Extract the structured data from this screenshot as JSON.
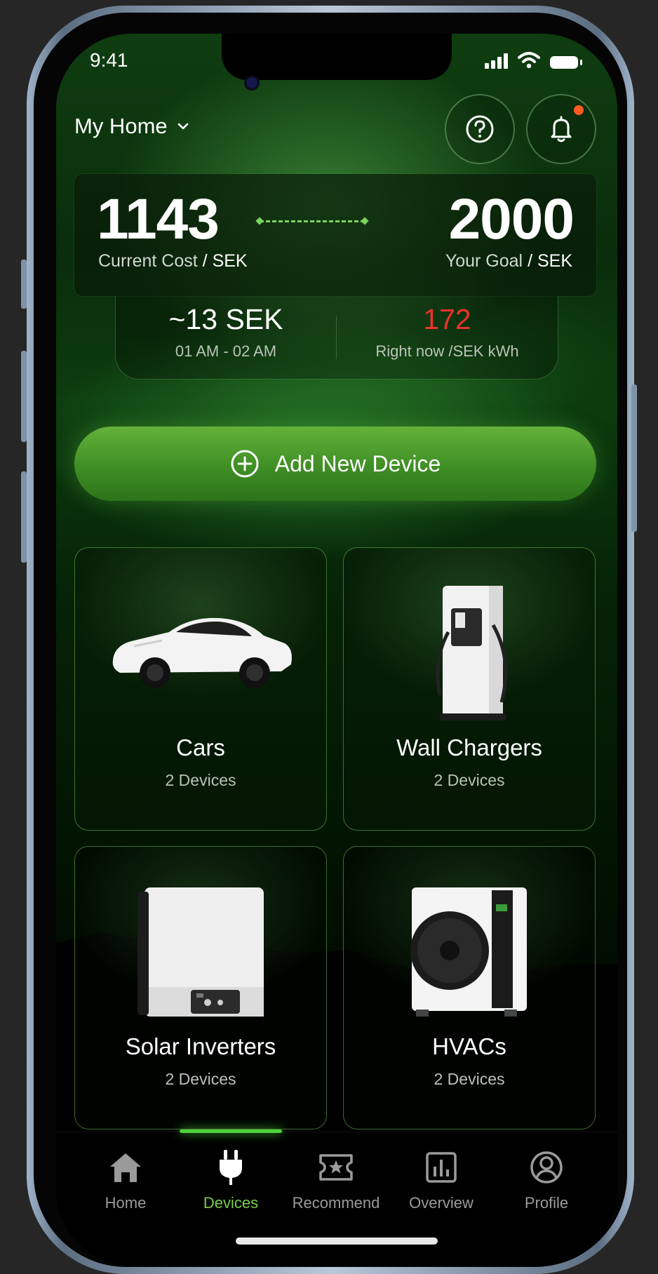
{
  "status_bar": {
    "time": "9:41"
  },
  "header": {
    "home_name": "My Home"
  },
  "cost": {
    "current_value": "1143",
    "current_label": "Current Cost",
    "current_unit": "/ SEK",
    "goal_value": "2000",
    "goal_label": "Your Goal",
    "goal_unit": "/ SEK"
  },
  "rates": {
    "estimate": "~13 SEK",
    "time_window": "01 AM - 02 AM",
    "current_price": "172",
    "current_price_label": "Right now /SEK kWh"
  },
  "add_device_label": "Add New Device",
  "devices": [
    {
      "title": "Cars",
      "count": "2 Devices",
      "icon": "car-image"
    },
    {
      "title": "Wall Chargers",
      "count": "2 Devices",
      "icon": "wall-charger-image"
    },
    {
      "title": "Solar Inverters",
      "count": "2 Devices",
      "icon": "solar-inverter-image"
    },
    {
      "title": "HVACs",
      "count": "2 Devices",
      "icon": "hvac-image"
    }
  ],
  "tabs": [
    {
      "label": "Home",
      "icon": "home-icon",
      "active": false
    },
    {
      "label": "Devices",
      "icon": "plug-icon",
      "active": true
    },
    {
      "label": "Recommend",
      "icon": "ticket-star-icon",
      "active": false
    },
    {
      "label": "Overview",
      "icon": "bar-chart-icon",
      "active": false
    },
    {
      "label": "Profile",
      "icon": "user-circle-icon",
      "active": false
    }
  ],
  "colors": {
    "accent_green": "#4fcf3c",
    "price_red": "#e8332b",
    "notification_dot": "#ff5a1f",
    "background": "#262626"
  }
}
